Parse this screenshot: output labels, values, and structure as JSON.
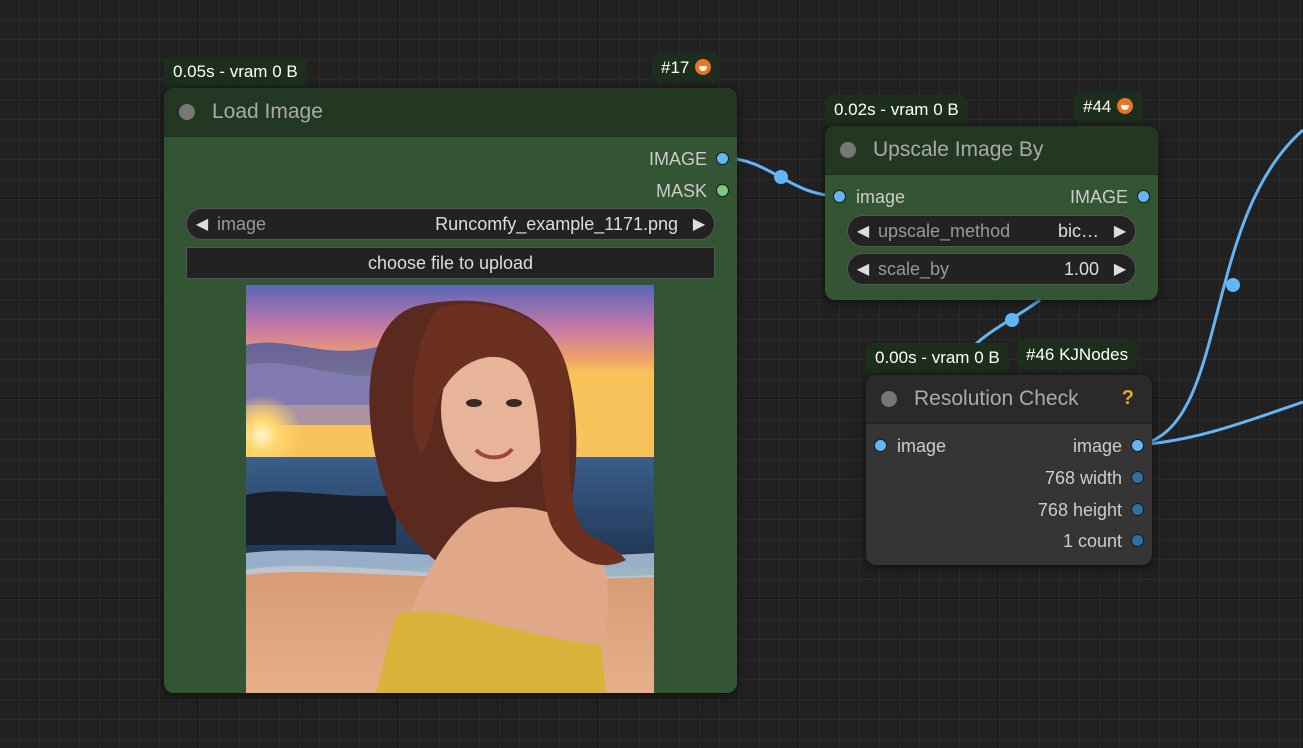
{
  "canvas": {
    "colors": {
      "background": "#212121",
      "link_image": "#64b5f6",
      "node_green": "#335533",
      "node_gray": "#353535"
    }
  },
  "nodes": {
    "load_image": {
      "timing": "0.05s - vram 0 B",
      "id_badge": "#17",
      "title": "Load Image",
      "outputs": [
        "IMAGE",
        "MASK"
      ],
      "widget": {
        "name": "image",
        "value": "Runcomfy_example_1171.png"
      },
      "upload_label": "choose file to upload",
      "preview_icon": "sunset-beach-portrait-image"
    },
    "upscale": {
      "timing": "0.02s - vram 0 B",
      "id_badge": "#44",
      "title": "Upscale Image By",
      "input": "image",
      "output": "IMAGE",
      "widgets": [
        {
          "name": "upscale_method",
          "value": "bic…"
        },
        {
          "name": "scale_by",
          "value": "1.00"
        }
      ]
    },
    "resolution": {
      "timing": "0.00s - vram 0 B",
      "id_badge": "#46 KJNodes",
      "title": "Resolution Check",
      "help": "?",
      "input": "image",
      "outputs": [
        "image",
        "768 width",
        "768 height",
        "1 count"
      ]
    }
  }
}
